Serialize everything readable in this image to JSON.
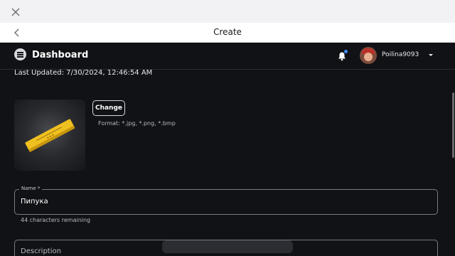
{
  "window": {
    "close_icon": "close-icon"
  },
  "nav": {
    "title": "Create",
    "back_icon": "chevron-left-icon"
  },
  "header": {
    "title": "Dashboard",
    "menu_icon": "menu-icon",
    "notification_icon": "bell-icon",
    "username": "Poilina9093",
    "dropdown_icon": "caret-down-icon"
  },
  "content": {
    "last_updated": "Last Updated: 7/30/2024, 12:46:54 AM",
    "change_label": "Change",
    "format_text": "Format: *.jpg, *.png, *.bmp",
    "name_label": "Name *",
    "name_value": "Пипука",
    "chars_remaining": "44 characters remaining",
    "description_label": "Description"
  },
  "colors": {
    "background": "#111216",
    "notification_dot": "#3b8df8",
    "item_gold": "#f0c020"
  }
}
